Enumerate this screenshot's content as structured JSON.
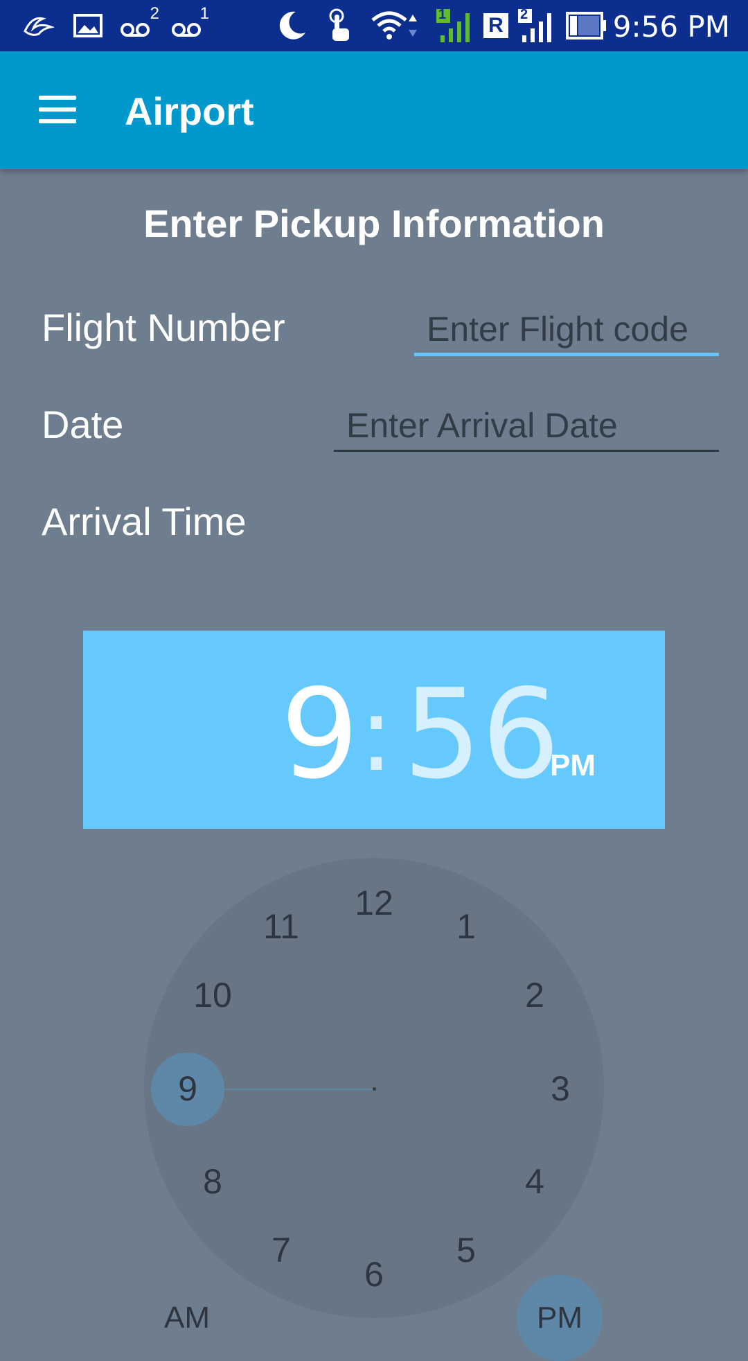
{
  "status_bar": {
    "time": "9:56 PM",
    "icons": [
      "bird-icon",
      "image-icon",
      "voicemail-icon",
      "voicemail-icon",
      "moon-icon",
      "touch-icon",
      "wifi-icon",
      "signal-icon",
      "roaming-icon",
      "signal-icon",
      "battery-icon"
    ],
    "voicemail1_count": "2",
    "voicemail2_count": "1",
    "sim1_label": "1",
    "roaming_label": "R",
    "sim2_label": "2"
  },
  "app_bar": {
    "title": "Airport",
    "menu_icon": "hamburger-menu-icon"
  },
  "form": {
    "title": "Enter Pickup Information",
    "flight_label": "Flight Number",
    "flight_placeholder": "Enter Flight code",
    "date_label": "Date",
    "date_placeholder": "Enter Arrival Date",
    "arrival_label": "Arrival Time"
  },
  "time_picker": {
    "hour": "9",
    "separator": ":",
    "minute": "56",
    "period": "PM",
    "selected_hour": 9,
    "hours": [
      "12",
      "1",
      "2",
      "3",
      "4",
      "5",
      "6",
      "7",
      "8",
      "9",
      "10",
      "11"
    ],
    "am_label": "AM",
    "pm_label": "PM",
    "selected_period": "PM"
  },
  "colors": {
    "status_bar": "#0b2e8f",
    "app_bar": "#0199cc",
    "background": "#6f7e8e",
    "time_header": "#66c9fd",
    "clock_face": "#677584",
    "accent": "#5f88a8",
    "focus_underline": "#67c5fd"
  }
}
